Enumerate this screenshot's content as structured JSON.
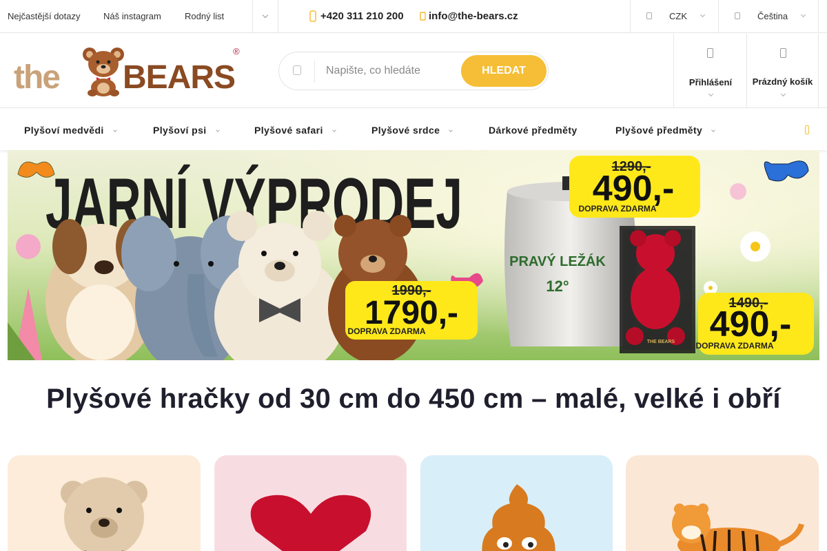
{
  "topbar": {
    "links": [
      "Nejčastější dotazy",
      "Náš instagram",
      "Rodný list"
    ],
    "phone": "+420 311 210 200",
    "email": "info@the-bears.cz",
    "currency": "CZK",
    "language": "Čeština"
  },
  "header": {
    "logo": {
      "text_the": "the",
      "text_bears": "BEARS",
      "registered": "®"
    },
    "search": {
      "placeholder": "Napište, co hledáte",
      "button": "HLEDAT"
    },
    "account_label": "Přihlášení",
    "cart_label": "Prázdný košík"
  },
  "nav": {
    "items": [
      {
        "label": "Plyšoví medvědi",
        "has_dropdown": true
      },
      {
        "label": "Plyšoví psi",
        "has_dropdown": true
      },
      {
        "label": "Plyšové safari",
        "has_dropdown": true
      },
      {
        "label": "Plyšové srdce",
        "has_dropdown": true
      },
      {
        "label": "Dárkové předměty",
        "has_dropdown": false
      },
      {
        "label": "Plyšové předměty",
        "has_dropdown": true
      }
    ]
  },
  "banner": {
    "headline": "JARNÍ VÝPRODEJ",
    "offers": [
      {
        "old_price": "1290,-",
        "price": "490,-",
        "note": "DOPRAVA ZDARMA"
      },
      {
        "old_price": "1990,-",
        "price": "1790,-",
        "note": "DOPRAVA ZDARMA"
      },
      {
        "old_price": "1490,-",
        "price": "490,-",
        "note": "DOPRAVA ZDARMA"
      }
    ],
    "keg_text": "PRAVÝ LEŽÁK",
    "keg_degree": "12°",
    "box_brand": "THE BEARS"
  },
  "main": {
    "heading": "Plyšové hračky od 30 cm do 450 cm – malé, velké i obří"
  },
  "categories": [
    {
      "image": "teddy-bear",
      "background": "#fcecd9"
    },
    {
      "image": "red-heart",
      "background": "#f7dde2"
    },
    {
      "image": "poop-emoji-pillow",
      "background": "#d8eef8"
    },
    {
      "image": "tiger",
      "background": "#fbe7d6"
    }
  ],
  "colors": {
    "accent": "#f5be36",
    "price_box": "#ffe81a",
    "text_dark": "#1f1f2e",
    "border": "#e6e6e6"
  }
}
